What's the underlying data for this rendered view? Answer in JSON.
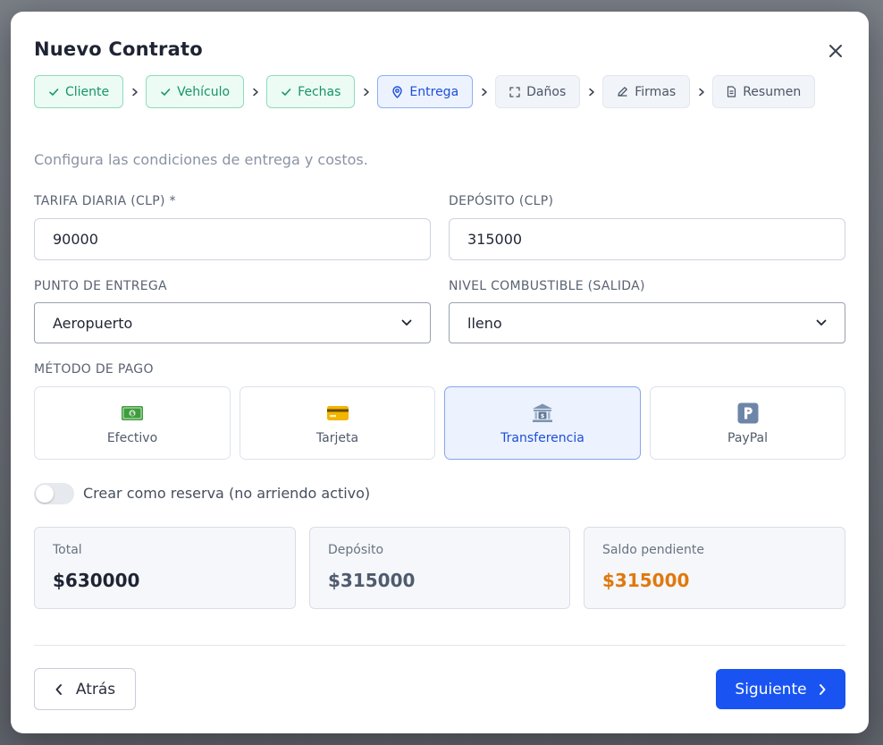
{
  "modal": {
    "title": "Nuevo Contrato",
    "subtitle": "Configura las condiciones de entrega y costos."
  },
  "steps": [
    {
      "label": "Cliente",
      "state": "done",
      "icon": "check-icon"
    },
    {
      "label": "Vehículo",
      "state": "done",
      "icon": "check-icon"
    },
    {
      "label": "Fechas",
      "state": "done",
      "icon": "check-icon"
    },
    {
      "label": "Entrega",
      "state": "active",
      "icon": "map-pin-icon"
    },
    {
      "label": "Daños",
      "state": "pending",
      "icon": "scan-icon"
    },
    {
      "label": "Firmas",
      "state": "pending",
      "icon": "pen-icon"
    },
    {
      "label": "Resumen",
      "state": "pending",
      "icon": "document-icon"
    }
  ],
  "form": {
    "daily_rate": {
      "label": "TARIFA DIARIA (CLP) *",
      "value": "90000"
    },
    "deposit": {
      "label": "DEPÓSITO (CLP)",
      "value": "315000"
    },
    "delivery_point": {
      "label": "PUNTO DE ENTREGA",
      "value": "Aeropuerto"
    },
    "fuel_level": {
      "label": "NIVEL COMBUSTIBLE (SALIDA)",
      "value": "lleno"
    },
    "payment_method": {
      "label": "MÉTODO DE PAGO",
      "options": [
        {
          "label": "Efectivo",
          "icon": "cash-icon"
        },
        {
          "label": "Tarjeta",
          "icon": "credit-card-icon"
        },
        {
          "label": "Transferencia",
          "icon": "bank-icon"
        },
        {
          "label": "PayPal",
          "icon": "paypal-icon"
        }
      ],
      "selected": "Transferencia"
    },
    "reservation_toggle": {
      "label": "Crear como reserva (no arriendo activo)",
      "on": false
    }
  },
  "summary": {
    "total": {
      "label": "Total",
      "value": "$630000"
    },
    "deposit": {
      "label": "Depósito",
      "value": "$315000"
    },
    "balance": {
      "label": "Saldo pendiente",
      "value": "$315000"
    }
  },
  "footer": {
    "back_label": "Atrás",
    "next_label": "Siguiente"
  },
  "colors": {
    "primary": "#1954f2",
    "done_green": "#179468",
    "balance_orange": "#e0780e",
    "deposit_slate": "#4f5b6e",
    "total_dark": "#1e2433"
  }
}
